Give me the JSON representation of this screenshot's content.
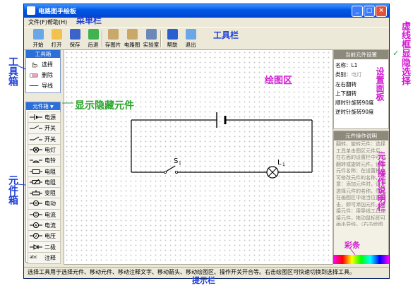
{
  "window": {
    "title": "电路图手绘板",
    "controls": [
      "_",
      "□",
      "×"
    ]
  },
  "menu": {
    "items": [
      {
        "label": "文件(F)"
      },
      {
        "label": "帮助(H)"
      }
    ]
  },
  "toolbar": {
    "buttons": [
      {
        "label": "开始",
        "icon": "new-document-icon",
        "color": "#6aa6e8"
      },
      {
        "label": "打开",
        "icon": "open-folder-icon",
        "color": "#f2c14e"
      },
      {
        "label": "保存",
        "icon": "save-disk-icon",
        "color": "#3b63c9"
      },
      {
        "label": "后退",
        "icon": "back-arrow-icon",
        "color": "#3fb34f"
      },
      {
        "label": "存图片",
        "icon": "save-image-icon",
        "color": "#c9a86a"
      },
      {
        "label": "电路图",
        "icon": "circuit-diagram-icon",
        "color": "#c9a86a"
      },
      {
        "label": "实验室",
        "icon": "laboratory-icon",
        "color": "#6c88b8"
      },
      {
        "label": "帮助",
        "icon": "help-icon",
        "color": "#2a5fd0"
      },
      {
        "label": "退出",
        "icon": "exit-icon",
        "color": "#6aa6e8"
      }
    ]
  },
  "toolbox": {
    "header": "工具箱",
    "tools": [
      {
        "label": "选择",
        "icon": "hand-pointer-icon"
      },
      {
        "label": "删除",
        "icon": "eraser-icon"
      },
      {
        "label": "导线",
        "icon": "wire-line-icon"
      }
    ]
  },
  "component_box": {
    "header": "元件箱",
    "dropdown_arrow": "▼",
    "items": [
      {
        "label": "电源",
        "icon": "battery-symbol-icon"
      },
      {
        "label": "开关",
        "icon": "switch-symbol-icon"
      },
      {
        "label": "开关",
        "icon": "switch-symbol-icon"
      },
      {
        "label": "电灯",
        "icon": "lamp-symbol-icon"
      },
      {
        "label": "电铃",
        "icon": "bell-symbol-icon"
      },
      {
        "label": "电阻",
        "icon": "resistor-symbol-icon"
      },
      {
        "label": "电阻箱",
        "icon": "resistance-box-icon"
      },
      {
        "label": "变阻器",
        "icon": "rheostat-symbol-icon"
      },
      {
        "label": "电动机",
        "icon": "motor-symbol-icon"
      },
      {
        "label": "电流计",
        "icon": "galvanometer-symbol-icon"
      },
      {
        "label": "电流表",
        "icon": "ammeter-symbol-icon"
      },
      {
        "label": "电压表",
        "icon": "voltmeter-symbol-icon"
      },
      {
        "label": "二极管",
        "icon": "diode-symbol-icon"
      },
      {
        "label": "注释",
        "icon_text": "abc",
        "icon": "text-annotation-icon"
      }
    ]
  },
  "drawing": {
    "switch_label": "S",
    "switch_sub": "1",
    "lamp_label": "L",
    "lamp_sub": "1"
  },
  "settings_panel": {
    "header": "当前元件设置",
    "name_label": "名称：",
    "name_value": "L1",
    "category_label": "类别：",
    "category_value": "电灯",
    "rows": [
      "左右翻转",
      "上下翻转",
      "顺时针旋转90度",
      "逆时针旋转90度"
    ]
  },
  "description_panel": {
    "header": "元件操作说明",
    "text": "翻转、旋转元件：选择工具单击图区元件后，在右面的设置栏中可以翻转或旋转元件。设置元件名称：在设置栏中可修改元件的名称，注意：添加元件时，请先选择元件的名称，然后在画图区中适当位置单击，即可添加元件。连接元件：用导线工具连接元件，拖动鼠标即可画出导线。（右击绘图区可切换到选择工具）"
  },
  "status_bar": {
    "text": "选择工具用于选择元件、移动元件、移动注释文字、移动箭头、移动绘图区、操作开关开合等。右击绘图区可快速切换到选择工具。"
  },
  "annotations": {
    "menubar": "菜单栏",
    "toolbar": "工具栏",
    "toolbox": "工具箱",
    "component_box": "元件箱",
    "show_hide": "显示隐藏元件",
    "drawing_area": "绘图区",
    "settings_panel": "设置面板",
    "description": "元件操作说明栏",
    "checkbox_select": "虚线框显隐选择",
    "colorbar": "彩条",
    "statusbar": "提示栏",
    "checkmark": "✓"
  },
  "colors": {
    "annotation_blue": "#1d3fd6",
    "annotation_magenta": "#d21ad2",
    "annotation_green": "#2ba52b",
    "title_bar": "#0055e5",
    "panel_header": "#2d6fd8"
  }
}
